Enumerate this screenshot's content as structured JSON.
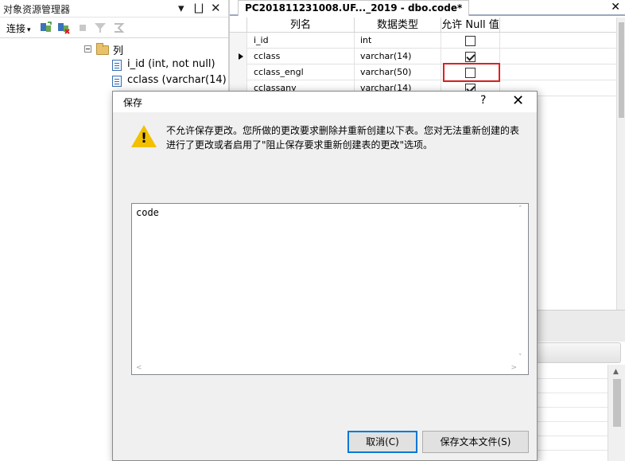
{
  "object_explorer": {
    "title": "对象资源管理器",
    "pin_glyph": "▾",
    "pin2_glyph": "⨆",
    "close_glyph": "✕",
    "connect_label": "连接",
    "connect_caret": "▾",
    "tree": {
      "folder_label": "列",
      "items": [
        {
          "label": "i_id (int, not null)"
        },
        {
          "label": "cclass (varchar(14)"
        }
      ]
    }
  },
  "document": {
    "tab_title": "PC201811231008.UF..._2019 - dbo.code*",
    "close_glyph": "✕",
    "columns": [
      "列名",
      "数据类型",
      "允许 Null 值"
    ],
    "rows": [
      {
        "name": "i_id",
        "type": "int",
        "allow_null": false
      },
      {
        "name": "cclass",
        "type": "varchar(14)",
        "allow_null": true
      },
      {
        "name": "cclass_engl",
        "type": "varchar(50)",
        "allow_null": false
      },
      {
        "name": "cclassany",
        "type": "varchar(14)",
        "allow_null": true
      }
    ],
    "selected_row": 1,
    "highlight_color": "#e02020"
  },
  "dialog": {
    "title": "保存",
    "help_glyph": "?",
    "close_glyph": "✕",
    "message": "不允许保存更改。您所做的更改要求删除并重新创建以下表。您对无法重新创建的表进行了更改或者启用了\"阻止保存要求重新创建表的更改\"选项。",
    "warning_glyph": "!",
    "list_items": [
      "code"
    ],
    "scroll_up": "˄",
    "scroll_down": "˅",
    "scroll_left": "<",
    "scroll_right": ">",
    "cancel_label": "取消(C)",
    "save_text_label": "保存文本文件(S)"
  }
}
